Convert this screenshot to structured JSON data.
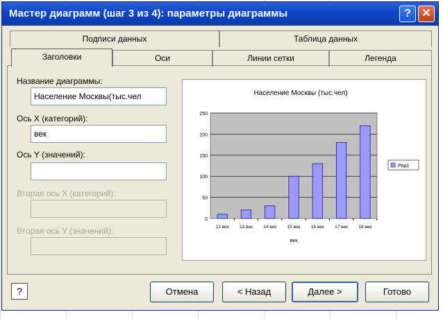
{
  "window": {
    "title": "Мастер диаграмм (шаг 3 из 4): параметры диаграммы",
    "help_glyph": "?",
    "close_glyph": "✕"
  },
  "tabs_top": [
    {
      "label": "Подписи данных"
    },
    {
      "label": "Таблица данных"
    }
  ],
  "tabs_bottom": [
    {
      "label": "Заголовки",
      "active": true
    },
    {
      "label": "Оси"
    },
    {
      "label": "Линии сетки"
    },
    {
      "label": "Легенда"
    }
  ],
  "fields": {
    "chart_title_label": "Название диаграммы:",
    "chart_title_value": "Население Москвы(тыс.чел",
    "x_axis_label": "Ось X (категорий):",
    "x_axis_value": "век",
    "y_axis_label": "Ось Y (значений):",
    "y_axis_value": "",
    "x2_axis_label": "Вторая ось X (категорий):",
    "y2_axis_label": "Вторая ось Y (значений):"
  },
  "buttons": {
    "help": "?",
    "cancel": "Отмена",
    "back": "< Назад",
    "next": "Далее >",
    "finish": "Готово"
  },
  "chart_data": {
    "type": "bar",
    "title": "Население Москвы (тыс.чел)",
    "xlabel": "век",
    "ylabel": "",
    "categories": [
      "12 век",
      "13 век",
      "14 век",
      "15 век",
      "16 век",
      "17 век",
      "18 век"
    ],
    "series": [
      {
        "name": "Ряд1",
        "values": [
          10,
          20,
          30,
          100,
          130,
          180,
          220
        ]
      }
    ],
    "ylim": [
      0,
      250
    ],
    "yticks": [
      "0",
      "50",
      "100",
      "150",
      "200",
      "250"
    ],
    "grid": true,
    "legend": "right",
    "colors": {
      "bar": "#9999ff",
      "plot_bg": "#c0c0c0",
      "bar_stroke": "#1a1a8a"
    }
  }
}
